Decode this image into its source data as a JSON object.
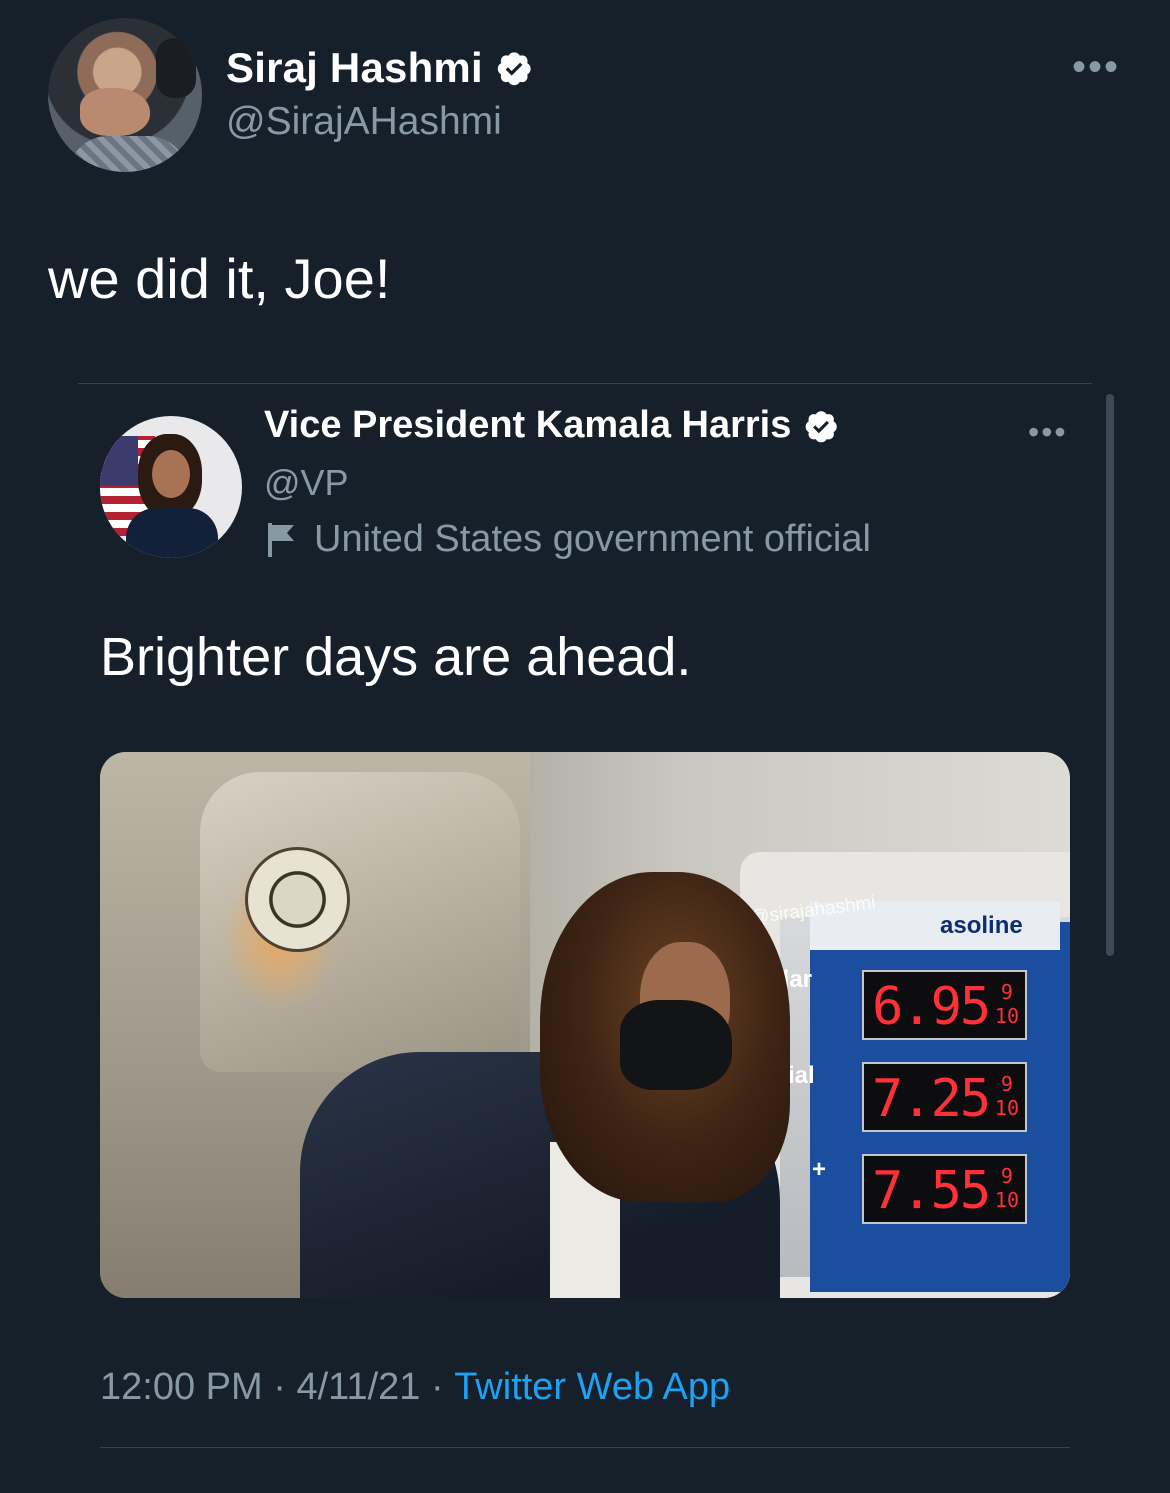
{
  "tweet": {
    "author_name": "Siraj Hashmi",
    "author_handle": "@SirajAHashmi",
    "text": "we did it, Joe!",
    "more_label": "•••"
  },
  "quoted": {
    "author_name": "Vice President Kamala Harris",
    "author_handle": "@VP",
    "label": "United States government official",
    "text": "Brighter days are ahead.",
    "more_label": "•••",
    "image": {
      "watermark": "@sirajahashmi",
      "sign_header": "asoline",
      "grades": [
        "ular",
        "ial",
        "+"
      ],
      "prices": [
        "6.95",
        "7.25",
        "7.55"
      ],
      "fraction_top": "9",
      "fraction_bottom": "10"
    }
  },
  "footer": {
    "time": "12:00 PM",
    "separator": " · ",
    "date": "4/11/21",
    "source": "Twitter Web App"
  },
  "colors": {
    "background": "#15202b",
    "secondary_text": "#8899a6",
    "accent": "#1da1f2",
    "divider": "#38444d",
    "price_led": "#ff3138"
  },
  "icons": {
    "verified": "verified-badge-icon",
    "label": "flag-icon",
    "more": "more-dots-icon"
  }
}
